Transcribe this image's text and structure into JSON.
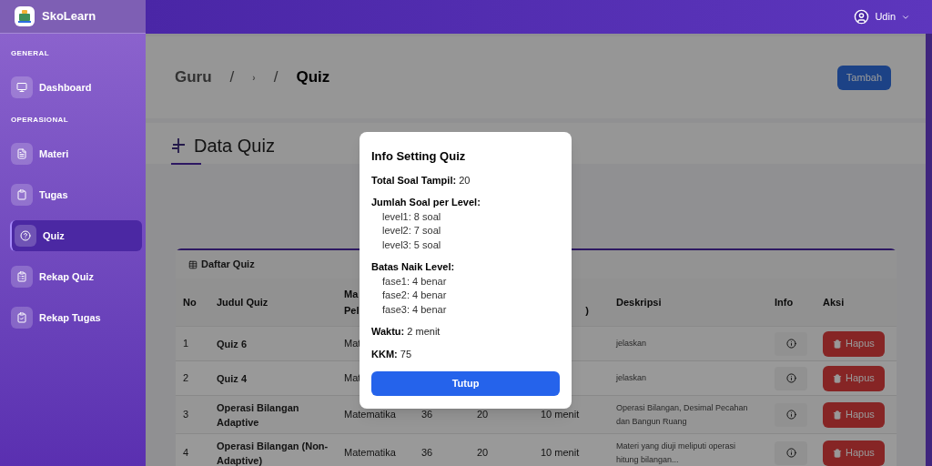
{
  "app": {
    "name": "SkoLearn"
  },
  "user": {
    "name": "Udin"
  },
  "sidebar": {
    "sections": [
      {
        "heading": "GENERAL",
        "items": [
          {
            "label": "Dashboard",
            "selected": false
          }
        ]
      },
      {
        "heading": "OPERASIONAL",
        "items": [
          {
            "label": "Materi",
            "selected": false
          },
          {
            "label": "Tugas",
            "selected": false
          },
          {
            "label": "Quiz",
            "selected": true
          },
          {
            "label": "Rekap Quiz",
            "selected": false
          },
          {
            "label": "Rekap Tugas",
            "selected": false
          }
        ]
      }
    ]
  },
  "breadcrumb": {
    "items": [
      "Guru",
      "›",
      "Quiz"
    ],
    "separator": "/"
  },
  "add_button": "Tambah",
  "section_title": "Data Quiz",
  "card": {
    "title": "Daftar Quiz",
    "header": {
      "no": "No",
      "judul": "Judul Quiz",
      "mapel": "Ma",
      "mapel_line_2": "Pel",
      "column_6": ")",
      "deskripsi": "Deskripsi",
      "info": "Info",
      "aksi": "Aksi"
    },
    "rows": [
      {
        "no": "1",
        "judul": "Quiz 6",
        "mapel": "Mat",
        "deskripsi": "jelaskan",
        "action": "Hapus"
      },
      {
        "no": "2",
        "judul": "Quiz 4",
        "mapel": "Mat",
        "deskripsi": "jelaskan",
        "action": "Hapus"
      },
      {
        "no": "3",
        "judul": "Operasi Bilangan Adaptive",
        "mapel": "Matematika",
        "column_4": "36",
        "column_5": "20",
        "column_6": "10 menit",
        "deskripsi": "Operasi Bilangan, Desimal Pecahan dan Bangun Ruang",
        "action": "Hapus"
      },
      {
        "no": "4",
        "judul": "Operasi Bilangan (Non-Adaptive)",
        "mapel": "Matematika",
        "column_4": "36",
        "column_5": "20",
        "column_6": "10 menit",
        "deskripsi": "Materi yang diuji meliputi operasi hitung bilangan...",
        "action": "Hapus"
      }
    ]
  },
  "modal": {
    "title": "Info Setting Quiz",
    "groups": [
      {
        "label": "Total Soal Tampil:",
        "value": "20"
      },
      {
        "label": "Jumlah Soal per Level:",
        "lines": [
          "level1: 8 soal",
          "level2: 7 soal",
          "level3: 5 soal"
        ]
      },
      {
        "label": "Batas Naik Level:",
        "lines": [
          "fase1: 4 benar",
          "fase2: 4 benar",
          "fase3: 4 benar"
        ]
      },
      {
        "label": "Waktu:",
        "value": "2 menit"
      },
      {
        "label": "KKM:",
        "value": "75"
      }
    ],
    "button": "Tutup"
  }
}
